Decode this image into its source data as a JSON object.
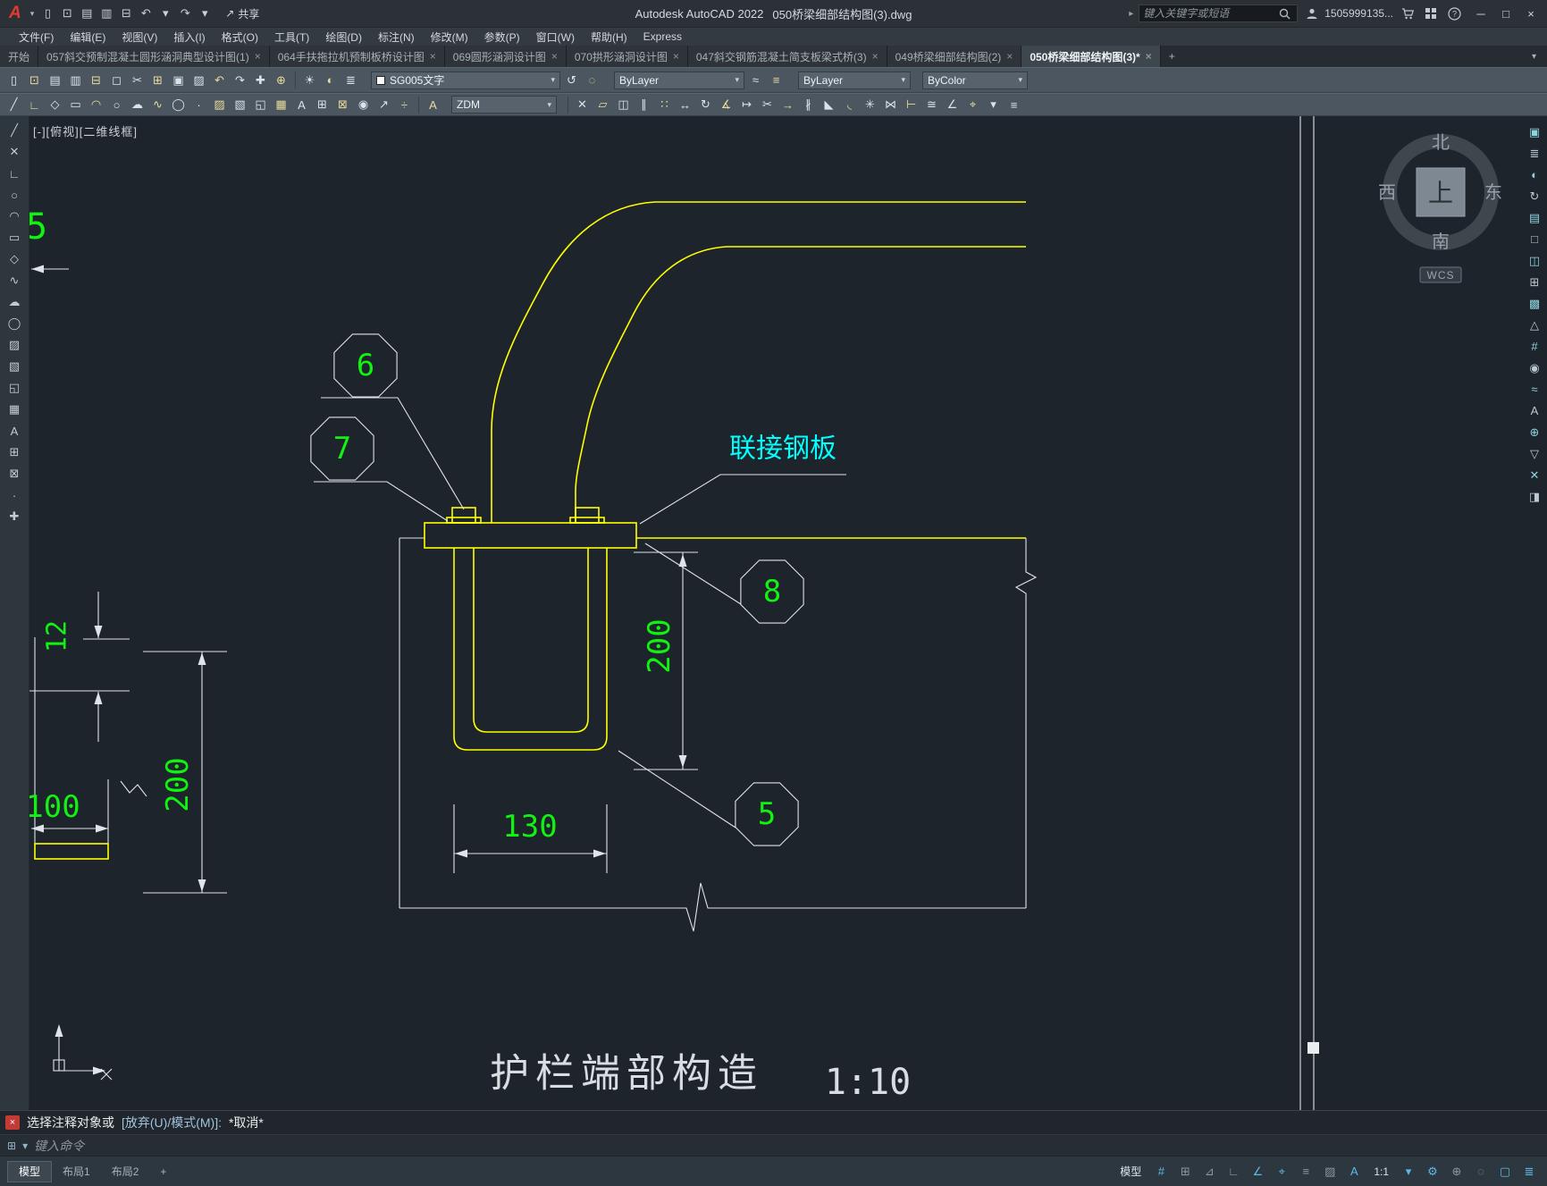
{
  "titlebar": {
    "logo": "A",
    "logo_caret": "▾",
    "qat_icons": [
      {
        "name": "qat-new-icon",
        "glyph": "▯"
      },
      {
        "name": "qat-open-icon",
        "glyph": "⊡"
      },
      {
        "name": "qat-save-icon",
        "glyph": "▤"
      },
      {
        "name": "qat-saveas-icon",
        "glyph": "▥"
      },
      {
        "name": "qat-plot-icon",
        "glyph": "⊟"
      },
      {
        "name": "qat-undo-icon",
        "glyph": "↶"
      },
      {
        "name": "qat-undo-caret-icon",
        "glyph": "▾"
      },
      {
        "name": "qat-redo-icon",
        "glyph": "↷"
      },
      {
        "name": "qat-redo-caret-icon",
        "glyph": "▾"
      }
    ],
    "share_icon": "↗",
    "share_label": "共享",
    "app_title": "Autodesk AutoCAD 2022",
    "doc_title": "050桥梁细部结构图(3).dwg",
    "search_chevron": "▸",
    "search_placeholder": "键入关键字或短语",
    "username": "1505999135...",
    "window_minimize": "─",
    "window_maximize": "□",
    "window_close": "×"
  },
  "menubar": {
    "items": [
      {
        "name": "menu-file",
        "label": "文件(F)"
      },
      {
        "name": "menu-edit",
        "label": "编辑(E)"
      },
      {
        "name": "menu-view",
        "label": "视图(V)"
      },
      {
        "name": "menu-insert",
        "label": "插入(I)"
      },
      {
        "name": "menu-format",
        "label": "格式(O)"
      },
      {
        "name": "menu-tools",
        "label": "工具(T)"
      },
      {
        "name": "menu-draw",
        "label": "绘图(D)"
      },
      {
        "name": "menu-dimension",
        "label": "标注(N)"
      },
      {
        "name": "menu-modify",
        "label": "修改(M)"
      },
      {
        "name": "menu-parametric",
        "label": "参数(P)"
      },
      {
        "name": "menu-window",
        "label": "窗口(W)"
      },
      {
        "name": "menu-help",
        "label": "帮助(H)"
      },
      {
        "name": "menu-express",
        "label": "Express"
      }
    ]
  },
  "tabbar": {
    "tabs": [
      {
        "name": "doc-tab-start",
        "label": "开始",
        "close": "",
        "cls": "dtab"
      },
      {
        "name": "doc-tab-057",
        "label": "057斜交预制混凝土圆形涵洞典型设计图(1)",
        "close": "×",
        "cls": "dtab"
      },
      {
        "name": "doc-tab-064",
        "label": "064手扶拖拉机预制板桥设计图",
        "close": "×",
        "cls": "dtab"
      },
      {
        "name": "doc-tab-069",
        "label": "069圆形涵洞设计图",
        "close": "×",
        "cls": "dtab"
      },
      {
        "name": "doc-tab-070",
        "label": "070拱形涵洞设计图",
        "close": "×",
        "cls": "dtab"
      },
      {
        "name": "doc-tab-047",
        "label": "047斜交钢筋混凝土简支板梁式桥(3)",
        "close": "×",
        "cls": "dtab"
      },
      {
        "name": "doc-tab-049",
        "label": "049桥梁细部结构图(2)",
        "close": "×",
        "cls": "dtab"
      },
      {
        "name": "doc-tab-050",
        "label": "050桥梁细部结构图(3)*",
        "close": "×",
        "cls": "dtab active"
      }
    ],
    "new_tab": "+",
    "overflow": "▾"
  },
  "toolbar1": {
    "file_icons": [
      {
        "name": "new-icon",
        "glyph": "▯"
      },
      {
        "name": "open-icon",
        "glyph": "⊡"
      },
      {
        "name": "save-icon",
        "glyph": "▤"
      },
      {
        "name": "saveas-icon",
        "glyph": "▥"
      },
      {
        "name": "plot-icon",
        "glyph": "⊟"
      },
      {
        "name": "preview-icon",
        "glyph": "◻"
      },
      {
        "name": "cut-icon",
        "glyph": "✂"
      },
      {
        "name": "copy-icon",
        "glyph": "⊞"
      },
      {
        "name": "paste-icon",
        "glyph": "▣"
      },
      {
        "name": "matchprop-icon",
        "glyph": "▨"
      },
      {
        "name": "undo-icon",
        "glyph": "↶"
      },
      {
        "name": "redo-icon",
        "glyph": "↷"
      },
      {
        "name": "pan-icon",
        "glyph": "✚"
      },
      {
        "name": "zoom-icon",
        "glyph": "⊕"
      }
    ],
    "layer_icons": [
      {
        "name": "layer-on-icon",
        "glyph": "☀"
      },
      {
        "name": "layer-freeze-icon",
        "glyph": "◐"
      },
      {
        "name": "layer-properties-icon",
        "glyph": "≣"
      }
    ],
    "layer_combo": "SG005文字",
    "mid_icons": [
      {
        "name": "layer-previous-icon",
        "glyph": "↺"
      },
      {
        "name": "layer-isolate-icon",
        "glyph": "◌"
      }
    ],
    "color_combo": "ByLayer",
    "mid_icons2": [
      {
        "name": "linetype-icon",
        "glyph": "≈"
      },
      {
        "name": "lineweight-icon",
        "glyph": "≡"
      }
    ],
    "linetype_combo": "ByLayer",
    "plotstyle_combo": "ByColor",
    "caret": "▾"
  },
  "toolbar2": {
    "draw_icons": [
      {
        "name": "line-icon",
        "glyph": "╱"
      },
      {
        "name": "polyline-icon",
        "glyph": "∟"
      },
      {
        "name": "polygon-icon",
        "glyph": "◇"
      },
      {
        "name": "rectangle-icon",
        "glyph": "▭"
      },
      {
        "name": "arc-icon",
        "glyph": "◠"
      },
      {
        "name": "circle-icon",
        "glyph": "○"
      },
      {
        "name": "revcloud-icon",
        "glyph": "☁"
      },
      {
        "name": "spline-icon",
        "glyph": "∿"
      },
      {
        "name": "ellipse-icon",
        "glyph": "◯"
      },
      {
        "name": "point-icon",
        "glyph": "·"
      },
      {
        "name": "hatch-icon",
        "glyph": "▨"
      },
      {
        "name": "gradient-icon",
        "glyph": "▧"
      },
      {
        "name": "region-icon",
        "glyph": "◱"
      },
      {
        "name": "table-icon",
        "glyph": "▦"
      },
      {
        "name": "mtext-icon",
        "glyph": "A"
      },
      {
        "name": "insert-block-icon",
        "glyph": "⊞"
      },
      {
        "name": "create-block-icon",
        "glyph": "⊠"
      },
      {
        "name": "donut-icon",
        "glyph": "◉"
      },
      {
        "name": "ray-icon",
        "glyph": "↗"
      },
      {
        "name": "divide-icon",
        "glyph": "÷"
      }
    ],
    "style_icon": "A",
    "style_combo": "ZDM",
    "modify_icons": [
      {
        "name": "erase-icon",
        "glyph": "✕"
      },
      {
        "name": "copy-object-icon",
        "glyph": "▱"
      },
      {
        "name": "mirror-icon",
        "glyph": "◫"
      },
      {
        "name": "offset-icon",
        "glyph": "∥"
      },
      {
        "name": "array-icon",
        "glyph": "∷"
      },
      {
        "name": "move-icon",
        "glyph": "↔"
      },
      {
        "name": "rotate-icon",
        "glyph": "↻"
      },
      {
        "name": "scale-icon",
        "glyph": "∡"
      },
      {
        "name": "stretch-icon",
        "glyph": "↦"
      },
      {
        "name": "trim-icon",
        "glyph": "✂"
      },
      {
        "name": "extend-icon",
        "glyph": "→"
      },
      {
        "name": "break-icon",
        "glyph": "∦"
      },
      {
        "name": "chamfer-icon",
        "glyph": "◣"
      },
      {
        "name": "fillet-icon",
        "glyph": "◟"
      },
      {
        "name": "explode-icon",
        "glyph": "✳"
      },
      {
        "name": "join-icon",
        "glyph": "⋈"
      },
      {
        "name": "dim-linear-icon",
        "glyph": "⊢"
      },
      {
        "name": "dim-aligned-icon",
        "glyph": "≅"
      },
      {
        "name": "dim-angular-icon",
        "glyph": "∠"
      },
      {
        "name": "center-mark-icon",
        "glyph": "⌖"
      },
      {
        "name": "more-caret-icon",
        "glyph": "▾"
      },
      {
        "name": "properties-icon",
        "glyph": "≡"
      }
    ]
  },
  "left_toolbar": {
    "icons": [
      {
        "name": "line-icon",
        "glyph": "╱"
      },
      {
        "name": "construction-line-icon",
        "glyph": "✕"
      },
      {
        "name": "polyline-icon",
        "glyph": "∟"
      },
      {
        "name": "circle-icon",
        "glyph": "○"
      },
      {
        "name": "arc-icon",
        "glyph": "◠"
      },
      {
        "name": "rectangle-icon",
        "glyph": "▭"
      },
      {
        "name": "polygon-icon",
        "glyph": "◇"
      },
      {
        "name": "spline-icon",
        "glyph": "∿"
      },
      {
        "name": "revcloud-icon",
        "glyph": "☁"
      },
      {
        "name": "ellipse-icon",
        "glyph": "◯"
      },
      {
        "name": "hatch-icon",
        "glyph": "▨"
      },
      {
        "name": "gradient-icon",
        "glyph": "▧"
      },
      {
        "name": "region-icon",
        "glyph": "◱"
      },
      {
        "name": "table-icon",
        "glyph": "▦"
      },
      {
        "name": "text-icon",
        "glyph": "A"
      },
      {
        "name": "insert-block-icon",
        "glyph": "⊞"
      },
      {
        "name": "create-block-icon",
        "glyph": "⊠"
      },
      {
        "name": "point-icon",
        "glyph": "·"
      },
      {
        "name": "move-icon",
        "glyph": "✚"
      }
    ]
  },
  "right_toolbar": {
    "icons": [
      {
        "name": "nav-properties-icon",
        "glyph": "▣"
      },
      {
        "name": "nav-layers-icon",
        "glyph": "≣"
      },
      {
        "name": "nav-materials-icon",
        "glyph": "◐"
      },
      {
        "name": "nav-refresh-icon",
        "glyph": "↻"
      },
      {
        "name": "nav-sheetset-icon",
        "glyph": "▤"
      },
      {
        "name": "nav-blank-icon",
        "glyph": "□"
      },
      {
        "name": "nav-viewport-icon",
        "glyph": "◫"
      },
      {
        "name": "nav-blocks-icon",
        "glyph": "⊞"
      },
      {
        "name": "nav-hatch-icon",
        "glyph": "▩"
      },
      {
        "name": "nav-orbit-icon",
        "glyph": "△"
      },
      {
        "name": "nav-grid-icon",
        "glyph": "#"
      },
      {
        "name": "nav-render-icon",
        "glyph": "◉"
      },
      {
        "name": "nav-measure-icon",
        "glyph": "≈"
      },
      {
        "name": "nav-text-icon",
        "glyph": "A"
      },
      {
        "name": "nav-add-icon",
        "glyph": "⊕"
      },
      {
        "name": "nav-collapse-icon",
        "glyph": "▽"
      },
      {
        "name": "nav-close-icon",
        "glyph": "✕"
      },
      {
        "name": "nav-split-icon",
        "glyph": "◨"
      }
    ]
  },
  "canvas": {
    "viewport_label": "[-][俯视][二维线框]",
    "plate_label": "联接钢板",
    "drawing_title": "护栏端部构造",
    "drawing_scale": "1:10",
    "dims": {
      "d200": "200",
      "d130": "130",
      "d100": "100",
      "d12": "12",
      "d5": "5",
      "d200_left": "200"
    },
    "callouts": {
      "c6": "6",
      "c7": "7",
      "c8": "8",
      "c5": "5"
    },
    "viewcube": {
      "north": "北",
      "south": "南",
      "west": "西",
      "east": "东",
      "top": "上",
      "wcs": "WCS"
    },
    "colors": {
      "line_yellow": "#ffff00",
      "dim_green": "#12f112",
      "label_cyan": "#00ffff",
      "line_gray": "#dfe4e8",
      "background": "#1d242b"
    }
  },
  "command": {
    "close_icon": "×",
    "prompt": "选择注释对象或",
    "options": "[放弃(U)/模式(M)]:",
    "result": "*取消*",
    "input_icon": "⊞",
    "input_caret": "▾",
    "input_hint": "键入命令"
  },
  "statusbar": {
    "layout_tabs": [
      {
        "name": "layout-tab-model",
        "label": "模型",
        "cls": "ltab active"
      },
      {
        "name": "layout-tab-layout1",
        "label": "布局1",
        "cls": "ltab"
      },
      {
        "name": "layout-tab-layout2",
        "label": "布局2",
        "cls": "ltab"
      },
      {
        "name": "layout-tab-new",
        "label": "+",
        "cls": "ltab"
      }
    ],
    "right_items": [
      {
        "name": "model-space-toggle",
        "glyph": "模型",
        "cls": "sbt on"
      },
      {
        "name": "grid-icon",
        "glyph": "#",
        "cls": "sbi on"
      },
      {
        "name": "snap-icon",
        "glyph": "⊞",
        "cls": "sbi"
      },
      {
        "name": "infer-constraints-icon",
        "glyph": "⊿",
        "cls": "sbi"
      },
      {
        "name": "ortho-icon",
        "glyph": "∟",
        "cls": "sbi"
      },
      {
        "name": "polar-icon",
        "glyph": "∠",
        "cls": "sbi on"
      },
      {
        "name": "osnap-icon",
        "glyph": "⌖",
        "cls": "sbi on"
      },
      {
        "name": "lineweight-icon",
        "glyph": "≡",
        "cls": "sbi"
      },
      {
        "name": "transparency-icon",
        "glyph": "▨",
        "cls": "sbi"
      },
      {
        "name": "annotation-icon",
        "glyph": "A",
        "cls": "sbi on"
      },
      {
        "name": "annotation-scale",
        "glyph": "1:1",
        "cls": "sbt on"
      },
      {
        "name": "scale-caret-icon",
        "glyph": "▾",
        "cls": "sbi on"
      },
      {
        "name": "workspace-icon",
        "glyph": "⚙",
        "cls": "sbi on"
      },
      {
        "name": "annotation-monitor-icon",
        "glyph": "⊕",
        "cls": "sbi"
      },
      {
        "name": "isolate-objects-icon",
        "glyph": "◌",
        "cls": "sbi"
      },
      {
        "name": "hardware-accel-icon",
        "glyph": "▢",
        "cls": "sbi on"
      },
      {
        "name": "customize-icon",
        "glyph": "≣",
        "cls": "sbi on"
      }
    ]
  }
}
